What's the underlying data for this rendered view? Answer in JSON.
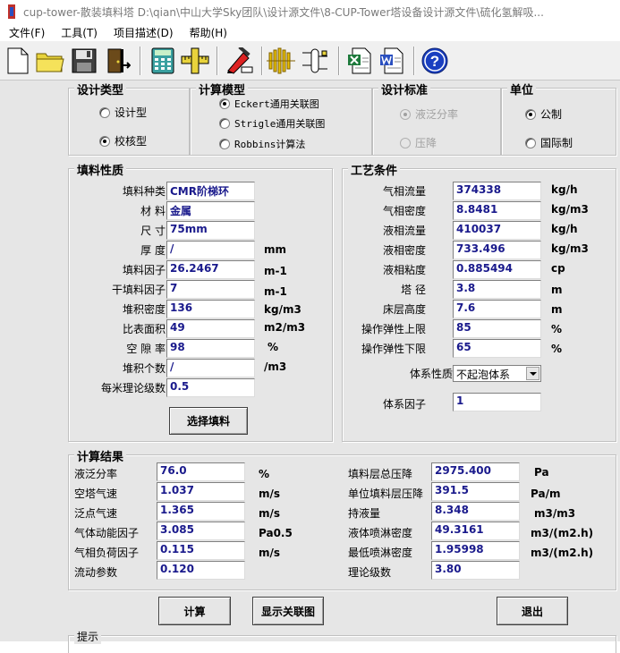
{
  "window": {
    "title": "cup-tower-散装填料塔    D:\\qian\\中山大学Sky团队\\设计源文件\\8-CUP-Tower塔设备设计源文件\\硫化氢解吸..."
  },
  "menu": [
    "文件(F)",
    "工具(T)",
    "项目描述(D)",
    "帮助(H)"
  ],
  "design_type": {
    "title": "设计类型",
    "options": [
      "设计型",
      "校核型"
    ],
    "selected": 1
  },
  "calc_model": {
    "title": "计算模型",
    "options": [
      "Eckert通用关联图",
      "Strigle通用关联图",
      "Robbins计算法"
    ],
    "selected": 0
  },
  "design_standard": {
    "title": "设计标准",
    "options": [
      "液泛分率",
      "压降"
    ],
    "selected": 0
  },
  "units": {
    "title": "单位",
    "options": [
      "公制",
      "国际制"
    ],
    "selected": 0
  },
  "packing": {
    "title": "填料性质",
    "rows": [
      {
        "label": "填料种类",
        "value": "CMR阶梯环",
        "unit": ""
      },
      {
        "label": "材    料",
        "value": "金属",
        "unit": ""
      },
      {
        "label": "尺    寸",
        "value": "75mm",
        "unit": ""
      },
      {
        "label": "厚    度",
        "value": "/",
        "unit": "mm"
      },
      {
        "label": "填料因子",
        "value": "26.2467",
        "unit": "m-1"
      },
      {
        "label": "干填料因子",
        "value": "7",
        "unit": "m-1"
      },
      {
        "label": "堆积密度",
        "value": "136",
        "unit": "kg/m3"
      },
      {
        "label": "比表面积",
        "value": "49",
        "unit": "m2/m3"
      },
      {
        "label": "空 隙 率",
        "value": "98",
        "unit": "%"
      },
      {
        "label": "堆积个数",
        "value": "/",
        "unit": "/m3"
      },
      {
        "label": "每米理论级数",
        "value": "0.5",
        "unit": ""
      }
    ],
    "select_button": "选择填料"
  },
  "process": {
    "title": "工艺条件",
    "rows": [
      {
        "label": "气相流量",
        "value": "374338",
        "unit": "kg/h"
      },
      {
        "label": "气相密度",
        "value": "8.8481",
        "unit": "kg/m3"
      },
      {
        "label": "液相流量",
        "value": "410037",
        "unit": "kg/h"
      },
      {
        "label": "液相密度",
        "value": "733.496",
        "unit": "kg/m3"
      },
      {
        "label": "液相粘度",
        "value": "0.885494",
        "unit": "cp"
      },
      {
        "label": "塔    径",
        "value": "3.8",
        "unit": "m"
      },
      {
        "label": "床层高度",
        "value": "7.6",
        "unit": "m"
      },
      {
        "label": "操作弹性上限",
        "value": "85",
        "unit": "%"
      },
      {
        "label": "操作弹性下限",
        "value": "65",
        "unit": "%"
      }
    ],
    "system_label": "体系性质",
    "system_value": "不起泡体系",
    "factor_label": "体系因子",
    "factor_value": "1"
  },
  "results": {
    "title": "计算结果",
    "left": [
      {
        "label": "液泛分率",
        "value": "76.0",
        "unit": "%"
      },
      {
        "label": "空塔气速",
        "value": "1.037",
        "unit": "m/s"
      },
      {
        "label": "泛点气速",
        "value": "1.365",
        "unit": "m/s"
      },
      {
        "label": "气体动能因子",
        "value": "3.085",
        "unit": "Pa0.5"
      },
      {
        "label": "气相负荷因子",
        "value": "0.115",
        "unit": "m/s"
      },
      {
        "label": "流动参数",
        "value": "0.120",
        "unit": ""
      }
    ],
    "right": [
      {
        "label": "填料层总压降",
        "value": "2975.400",
        "unit": "Pa"
      },
      {
        "label": "单位填料层压降",
        "value": "391.5",
        "unit": "Pa/m"
      },
      {
        "label": "持液量",
        "value": "8.348",
        "unit": "m3/m3"
      },
      {
        "label": "液体喷淋密度",
        "value": "49.3161",
        "unit": "m3/(m2.h)"
      },
      {
        "label": "最低喷淋密度",
        "value": "1.95998",
        "unit": "m3/(m2.h)"
      },
      {
        "label": "理论级数",
        "value": "3.80",
        "unit": ""
      }
    ]
  },
  "buttons": {
    "calc": "计算",
    "show_chart": "显示关联图",
    "exit": "退出"
  },
  "hint": {
    "title": "提示"
  }
}
